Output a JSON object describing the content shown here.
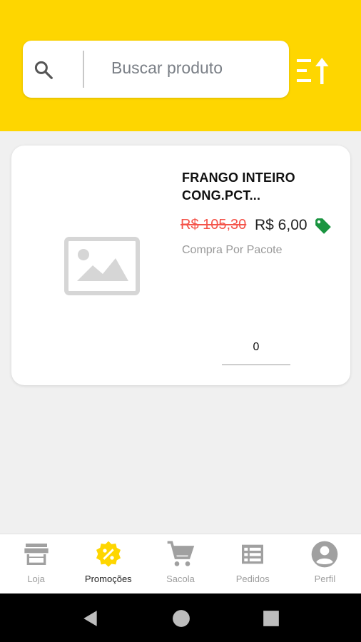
{
  "search": {
    "placeholder": "Buscar produto"
  },
  "product": {
    "title": "FRANGO INTEIRO CONG.PCT...",
    "old_price": "R$ 105,30",
    "new_price": "R$ 6,00",
    "subtitle": "Compra Por Pacote",
    "quantity": "0"
  },
  "nav": {
    "items": [
      {
        "label": "Loja",
        "icon": "store-icon"
      },
      {
        "label": "Promoções",
        "icon": "discount-badge-icon"
      },
      {
        "label": "Sacola",
        "icon": "cart-icon"
      },
      {
        "label": "Pedidos",
        "icon": "list-icon"
      },
      {
        "label": "Perfil",
        "icon": "account-icon"
      }
    ],
    "active_index": 1
  },
  "colors": {
    "header": "#fed600",
    "tag": "#1a9440",
    "old_price": "#f4544a"
  }
}
